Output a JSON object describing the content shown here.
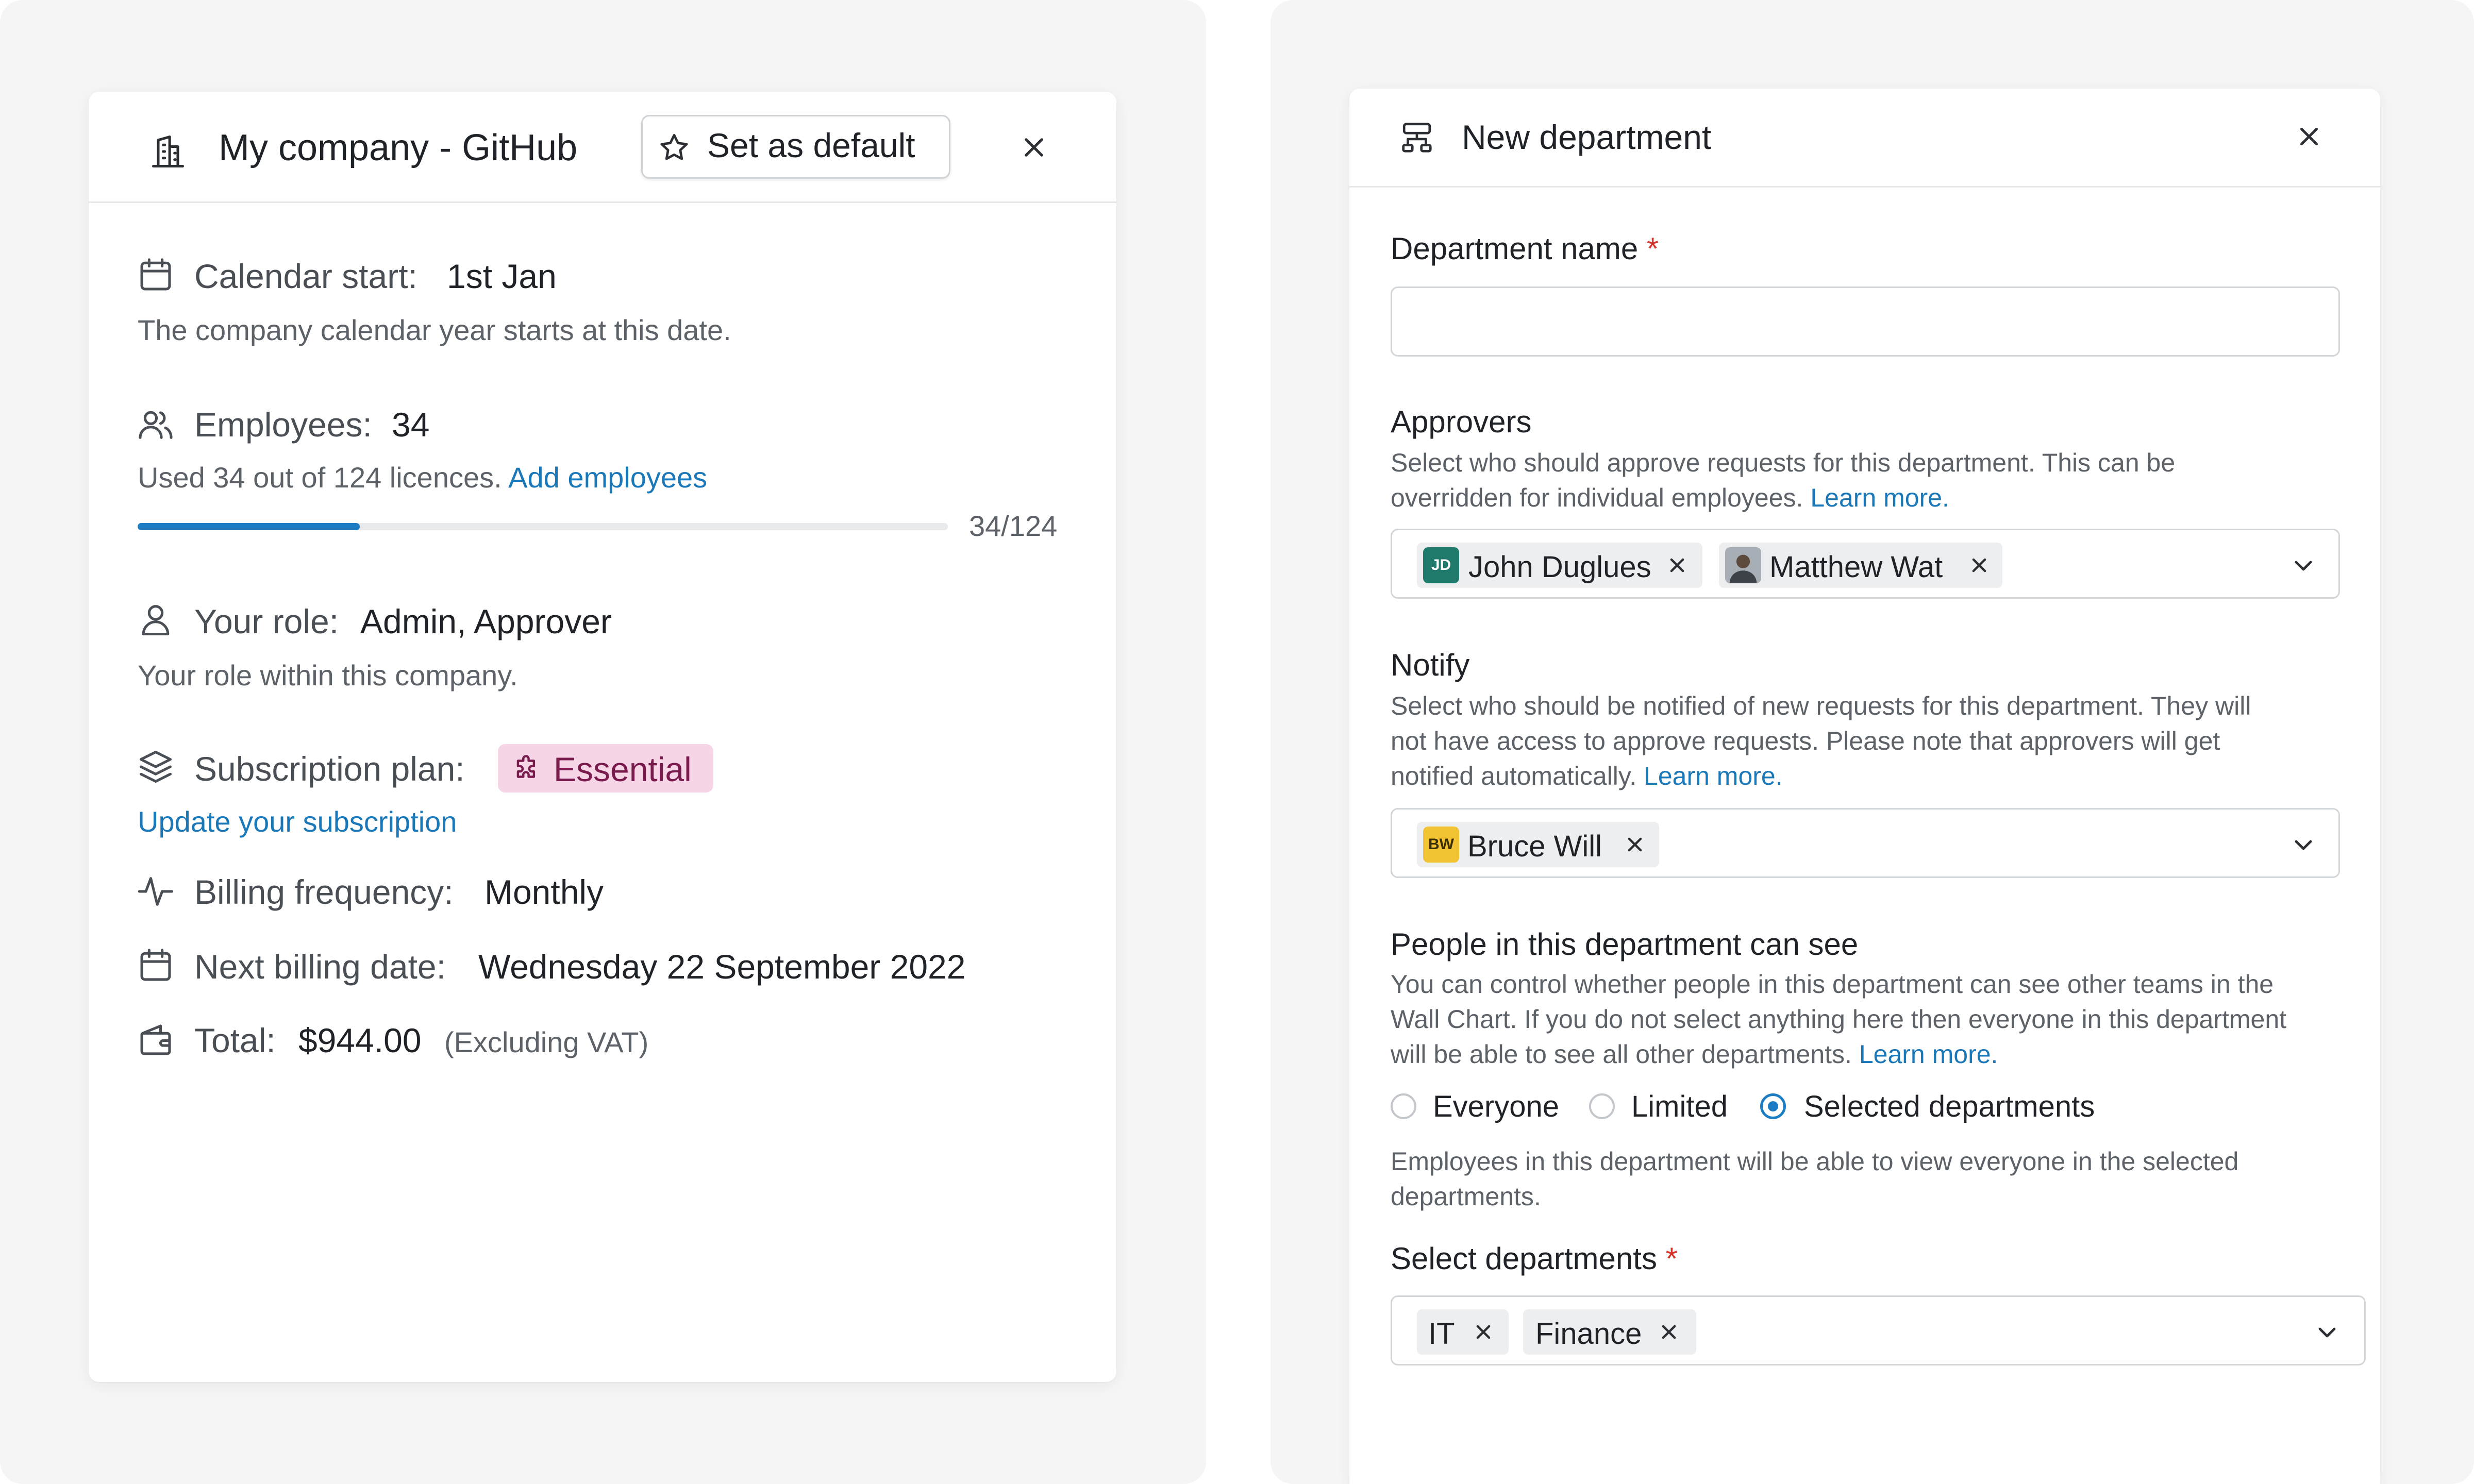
{
  "company_card": {
    "title": "My company - GitHub",
    "set_default_label": "Set as default",
    "calendar": {
      "label": "Calendar start:",
      "value": "1st Jan",
      "description": "The company calendar year starts at this date."
    },
    "employees": {
      "label": "Employees:",
      "value": "34",
      "usage_text": "Used 34 out of 124 licences.",
      "add_link": "Add employees",
      "progress_text": "34/124",
      "progress_used": 34,
      "progress_total": 124
    },
    "role": {
      "label": "Your role:",
      "value": "Admin, Approver",
      "description": "Your role within this company."
    },
    "subscription": {
      "label": "Subscription plan:",
      "plan": "Essential",
      "update_link": "Update your subscription"
    },
    "billing_frequency": {
      "label": "Billing frequency:",
      "value": "Monthly"
    },
    "next_billing": {
      "label": "Next billing date:",
      "value": "Wednesday 22 September 2022"
    },
    "total": {
      "label": "Total:",
      "value": "$944.00",
      "note": "(Excluding VAT)"
    }
  },
  "department_card": {
    "title": "New department",
    "department_name": {
      "label": "Department name",
      "required_mark": "*",
      "value": "",
      "placeholder": ""
    },
    "approvers": {
      "label": "Approvers",
      "help_line1": "Select who should approve requests for this department. This can be",
      "help_line2": "overridden for individual employees.",
      "learn_more": "Learn more.",
      "chips": [
        {
          "initials": "JD",
          "name": "John Duglues"
        },
        {
          "initials": "",
          "name": "Matthew Wat"
        }
      ]
    },
    "notify": {
      "label": "Notify",
      "help_line1": "Select who should be notified of new requests for this department. They will",
      "help_line2": "not have access to approve requests. Please note that approvers will get",
      "help_line3": "notified automatically.",
      "learn_more": "Learn more.",
      "chips": [
        {
          "initials": "BW",
          "name": "Bruce Will"
        }
      ]
    },
    "visibility": {
      "label": "People in this department can see",
      "help_line1": "You can control whether people in this department can see other teams in the",
      "help_line2": "Wall Chart. If you do not select anything here then everyone in this department",
      "help_line3": "will be able to see all other departments.",
      "learn_more": "Learn more.",
      "options": [
        "Everyone",
        "Limited",
        "Selected departments"
      ],
      "selected": "Selected departments",
      "note_line1": "Employees in this department will be able to view everyone in the selected",
      "note_line2": "departments."
    },
    "select_departments": {
      "label": "Select departments",
      "required_mark": "*",
      "chips": [
        "IT",
        "Finance"
      ]
    }
  },
  "colors": {
    "accent": "#1a7dc4",
    "link": "#1a78b8",
    "required": "#d9342b",
    "badge_bg": "#f6d5e6",
    "badge_text": "#7a1b4e",
    "avatar_jd": "#1f7a6b",
    "avatar_bw": "#f1c232"
  },
  "icons": [
    "building-icon",
    "star-icon",
    "close-icon",
    "calendar-icon",
    "users-icon",
    "user-icon",
    "layers-icon",
    "puzzle-icon",
    "activity-icon",
    "wallet-icon",
    "sitemap-icon",
    "chevron-down-icon"
  ]
}
